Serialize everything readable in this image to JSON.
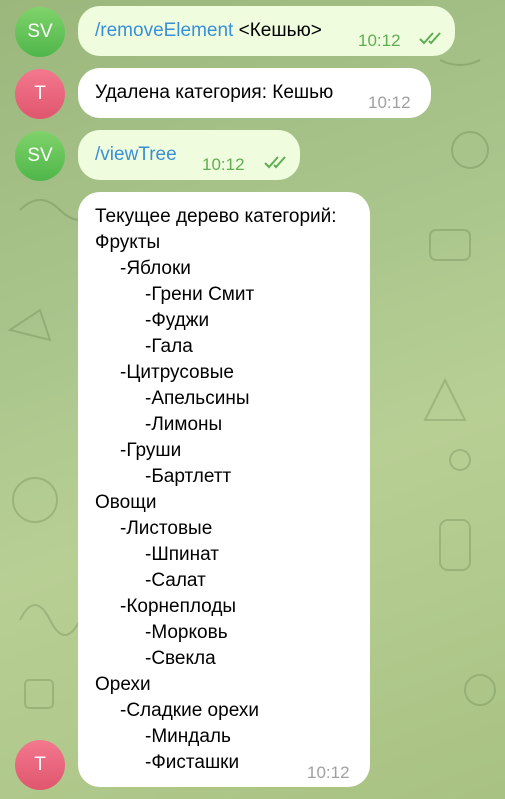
{
  "messages": [
    {
      "sender": "SV",
      "command": "/removeElement",
      "arg": " <Кешью>",
      "time": "10:12"
    },
    {
      "sender": "T",
      "text": "Удалена категория: Кешью",
      "time": "10:12"
    },
    {
      "sender": "SV",
      "command": "/viewTree",
      "time": "10:12"
    },
    {
      "sender": "T",
      "time": "10:12",
      "tree_title": "Текущее дерево категорий:",
      "tree": [
        "Фрукты",
        "-Яблоки",
        "-Грени Смит",
        "-Фуджи",
        "-Гала",
        "-Цитрусовые",
        "-Апельсины",
        "-Лимоны",
        "-Груши",
        "-Бартлетт",
        "Овощи",
        "-Листовые",
        "-Шпинат",
        "-Салат",
        "-Корнеплоды",
        "-Морковь",
        "-Свекла",
        "Орехи",
        "-Сладкие орехи",
        "-Миндаль",
        "-Фисташки"
      ]
    }
  ],
  "colors": {
    "outgoing_bubble": "#effdde",
    "incoming_bubble": "#ffffff",
    "command_link": "#3a8fd6",
    "read_check": "#5fae54"
  }
}
